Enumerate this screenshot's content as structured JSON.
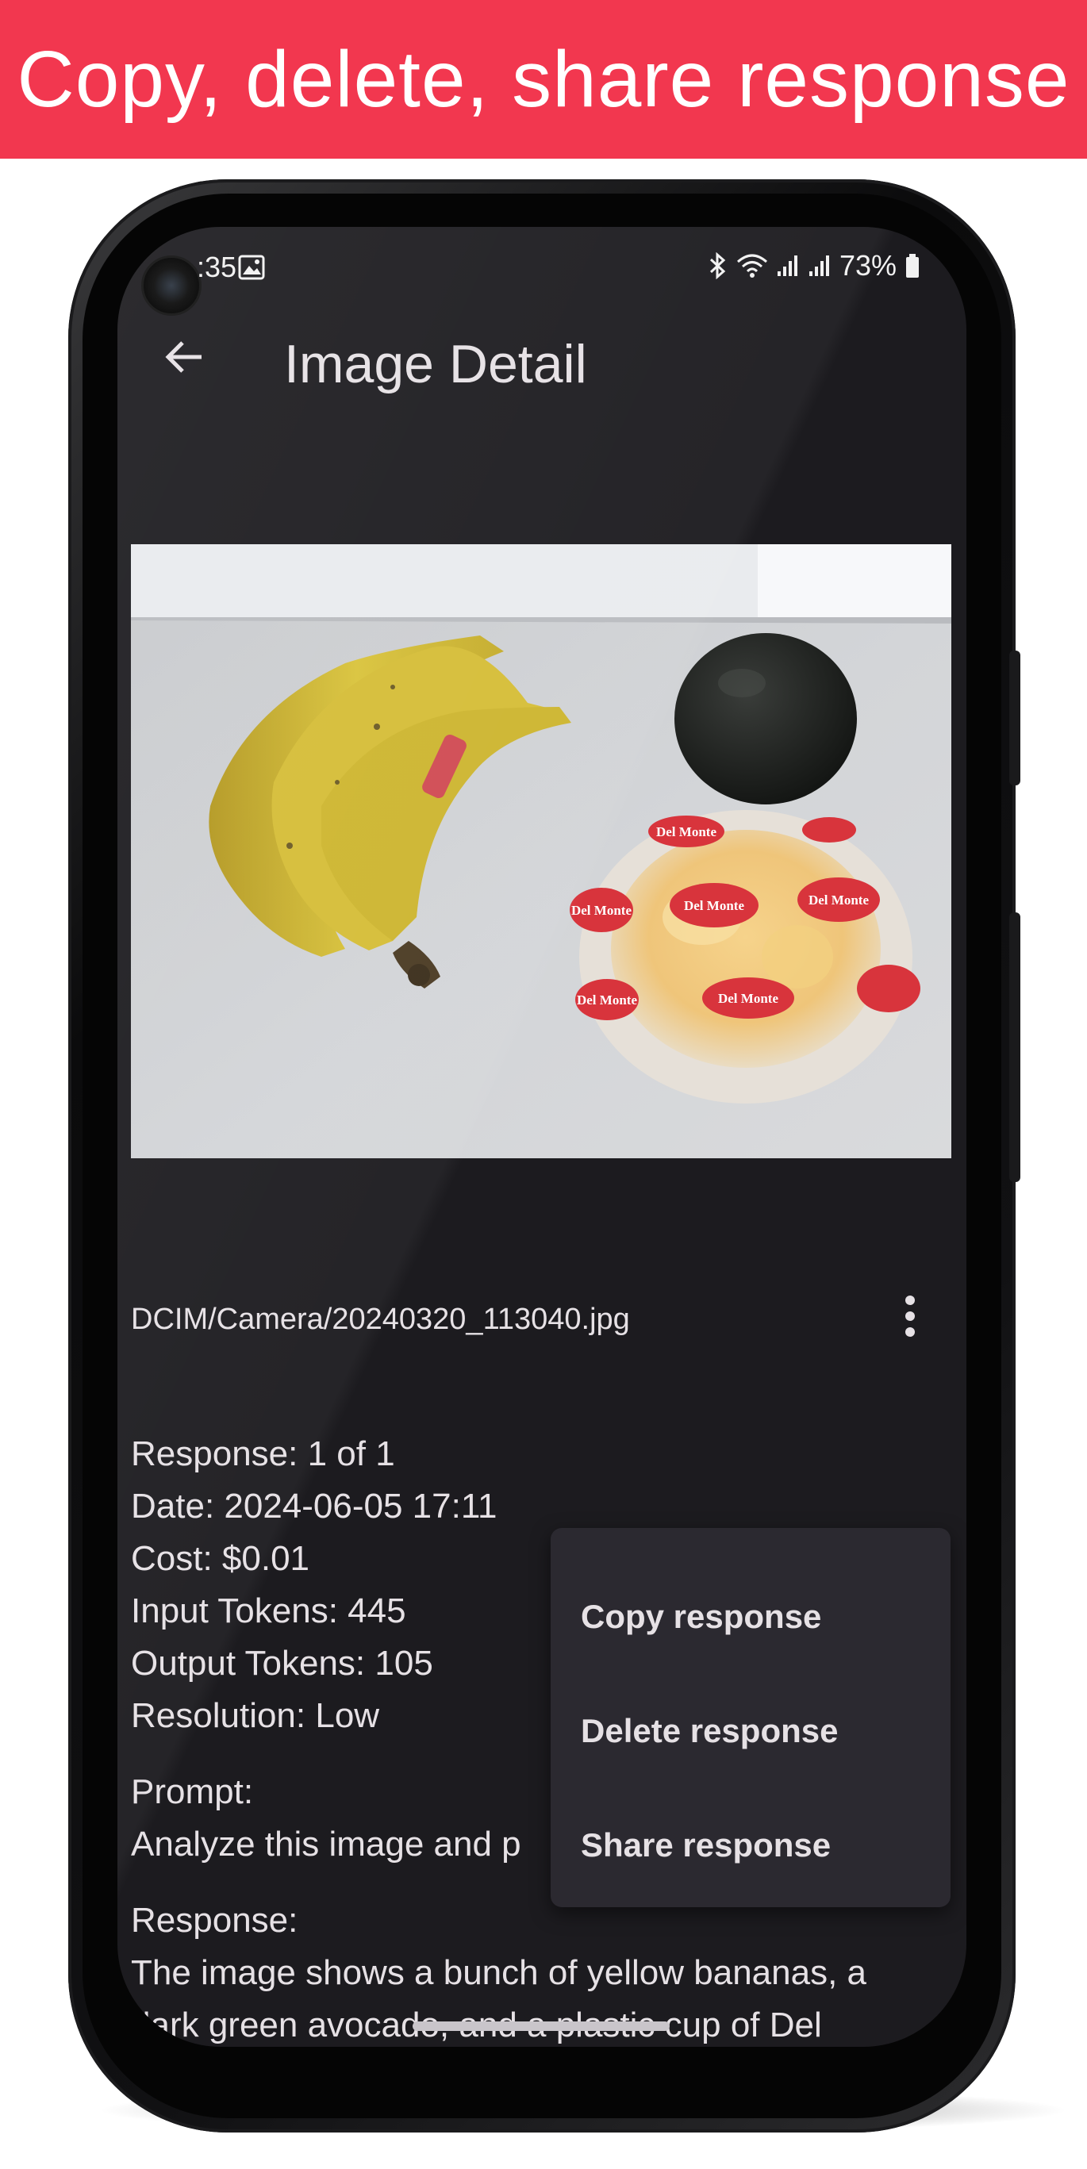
{
  "banner": {
    "title": "Copy, delete, share response",
    "color": "#f2374f"
  },
  "status_bar": {
    "time": ":35",
    "battery": "73%",
    "icons": [
      "image-icon",
      "bluetooth-icon",
      "wifi-icon",
      "signal-icon",
      "signal-icon",
      "battery-icon"
    ]
  },
  "app_bar": {
    "title": "Image Detail",
    "back_icon": "arrow-left-icon"
  },
  "image": {
    "description_icon": "photo",
    "brand_labels": [
      "Del Monte",
      "Del Monte",
      "Del Monte",
      "Del Monte",
      "Del Monte",
      "Del Monte"
    ]
  },
  "file": {
    "path": "DCIM/Camera/20240320_113040.jpg",
    "more_icon": "more-vert-icon"
  },
  "details": {
    "response_index": "Response: 1 of 1",
    "date": "Date: 2024-06-05 17:11",
    "cost": "Cost: $0.01",
    "input_tokens": "Input Tokens: 445",
    "output_tokens": "Output Tokens: 105",
    "resolution": "Resolution: Low",
    "prompt_label": "Prompt:",
    "prompt_text": "Analyze this image and p",
    "response_label": "Response:",
    "response_line1": "The image shows a bunch of yellow bananas, a",
    "response_line2": "dark green avocado, and a plastic cup of Del"
  },
  "menu": {
    "items": [
      {
        "label": "Copy response"
      },
      {
        "label": "Delete response"
      },
      {
        "label": "Share response"
      }
    ]
  },
  "colors": {
    "screen_bg": "#1c1b1f",
    "menu_bg": "#2b2930",
    "text": "#e6e1e5"
  }
}
